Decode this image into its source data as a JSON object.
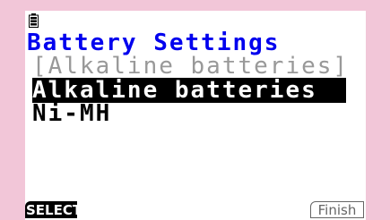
{
  "status_bar": {
    "icon": "battery-icon"
  },
  "title": "Battery Settings",
  "current_setting": "[Alkaline batteries]",
  "options": [
    {
      "label": "Alkaline batteries",
      "selected": true
    },
    {
      "label": "Ni-MH",
      "selected": false
    }
  ],
  "function_keys": {
    "f1_label": "SELECT",
    "f6_label": "Finish"
  },
  "colors": {
    "title": "#0000ee",
    "current_setting": "#999999",
    "frame": "#f2c6d8",
    "selection_bg": "#000000"
  }
}
